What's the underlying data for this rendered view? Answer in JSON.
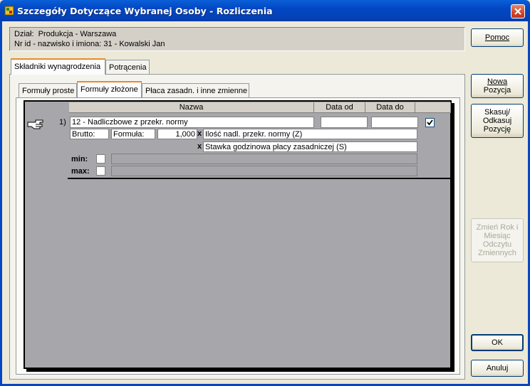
{
  "window": {
    "title": "Szczegóły Dotyczące Wybranej Osoby - Rozliczenia"
  },
  "info": {
    "dept_label": "Dział:",
    "dept_value": "Produkcja - Warszawa",
    "person_label": "Nr id - nazwisko i imiona:",
    "person_value": "31 - Kowalski Jan"
  },
  "buttons": {
    "help": "Pomoc",
    "new_line1": "Nowa",
    "new_line2": "Pozycja",
    "delete_line1": "Skasuj/",
    "delete_line2": "Odkasuj",
    "delete_line3": "Pozycję",
    "change_line1": "Zmień Rok i",
    "change_line2": "Miesiąc",
    "change_line3": "Odczytu",
    "change_line4": "Zmiennych",
    "ok": "OK",
    "cancel": "Anuluj"
  },
  "tabs": {
    "main": [
      "Składniki wynagrodzenia",
      "Potrącenia"
    ],
    "sub": [
      "Formuły proste",
      "Formuły złożone",
      "Płaca zasadn. i inne zmienne"
    ]
  },
  "grid": {
    "columns": {
      "name": "Nazwa",
      "date_from": "Data od",
      "date_to": "Data do"
    },
    "rows": [
      {
        "index": "1)",
        "name": "12 - Nadliczbowe z przekr. normy",
        "date_from": "",
        "date_to": "",
        "checked": true,
        "type_value": "Brutto:",
        "formula_label": "Formuła:",
        "factor": "1,000",
        "operator1": "x",
        "variable1": "Ilość nadl. przekr. normy (Z)",
        "operator2": "x",
        "variable2": "Stawka godzinowa płacy zasadniczej (S)",
        "min_label": "min:",
        "max_label": "max:",
        "min_value": "",
        "max_value": ""
      }
    ]
  },
  "colors": {
    "titlebar": "#0347c4",
    "grid_bg": "#a7a6aa",
    "window_bg": "#ece9d8"
  }
}
